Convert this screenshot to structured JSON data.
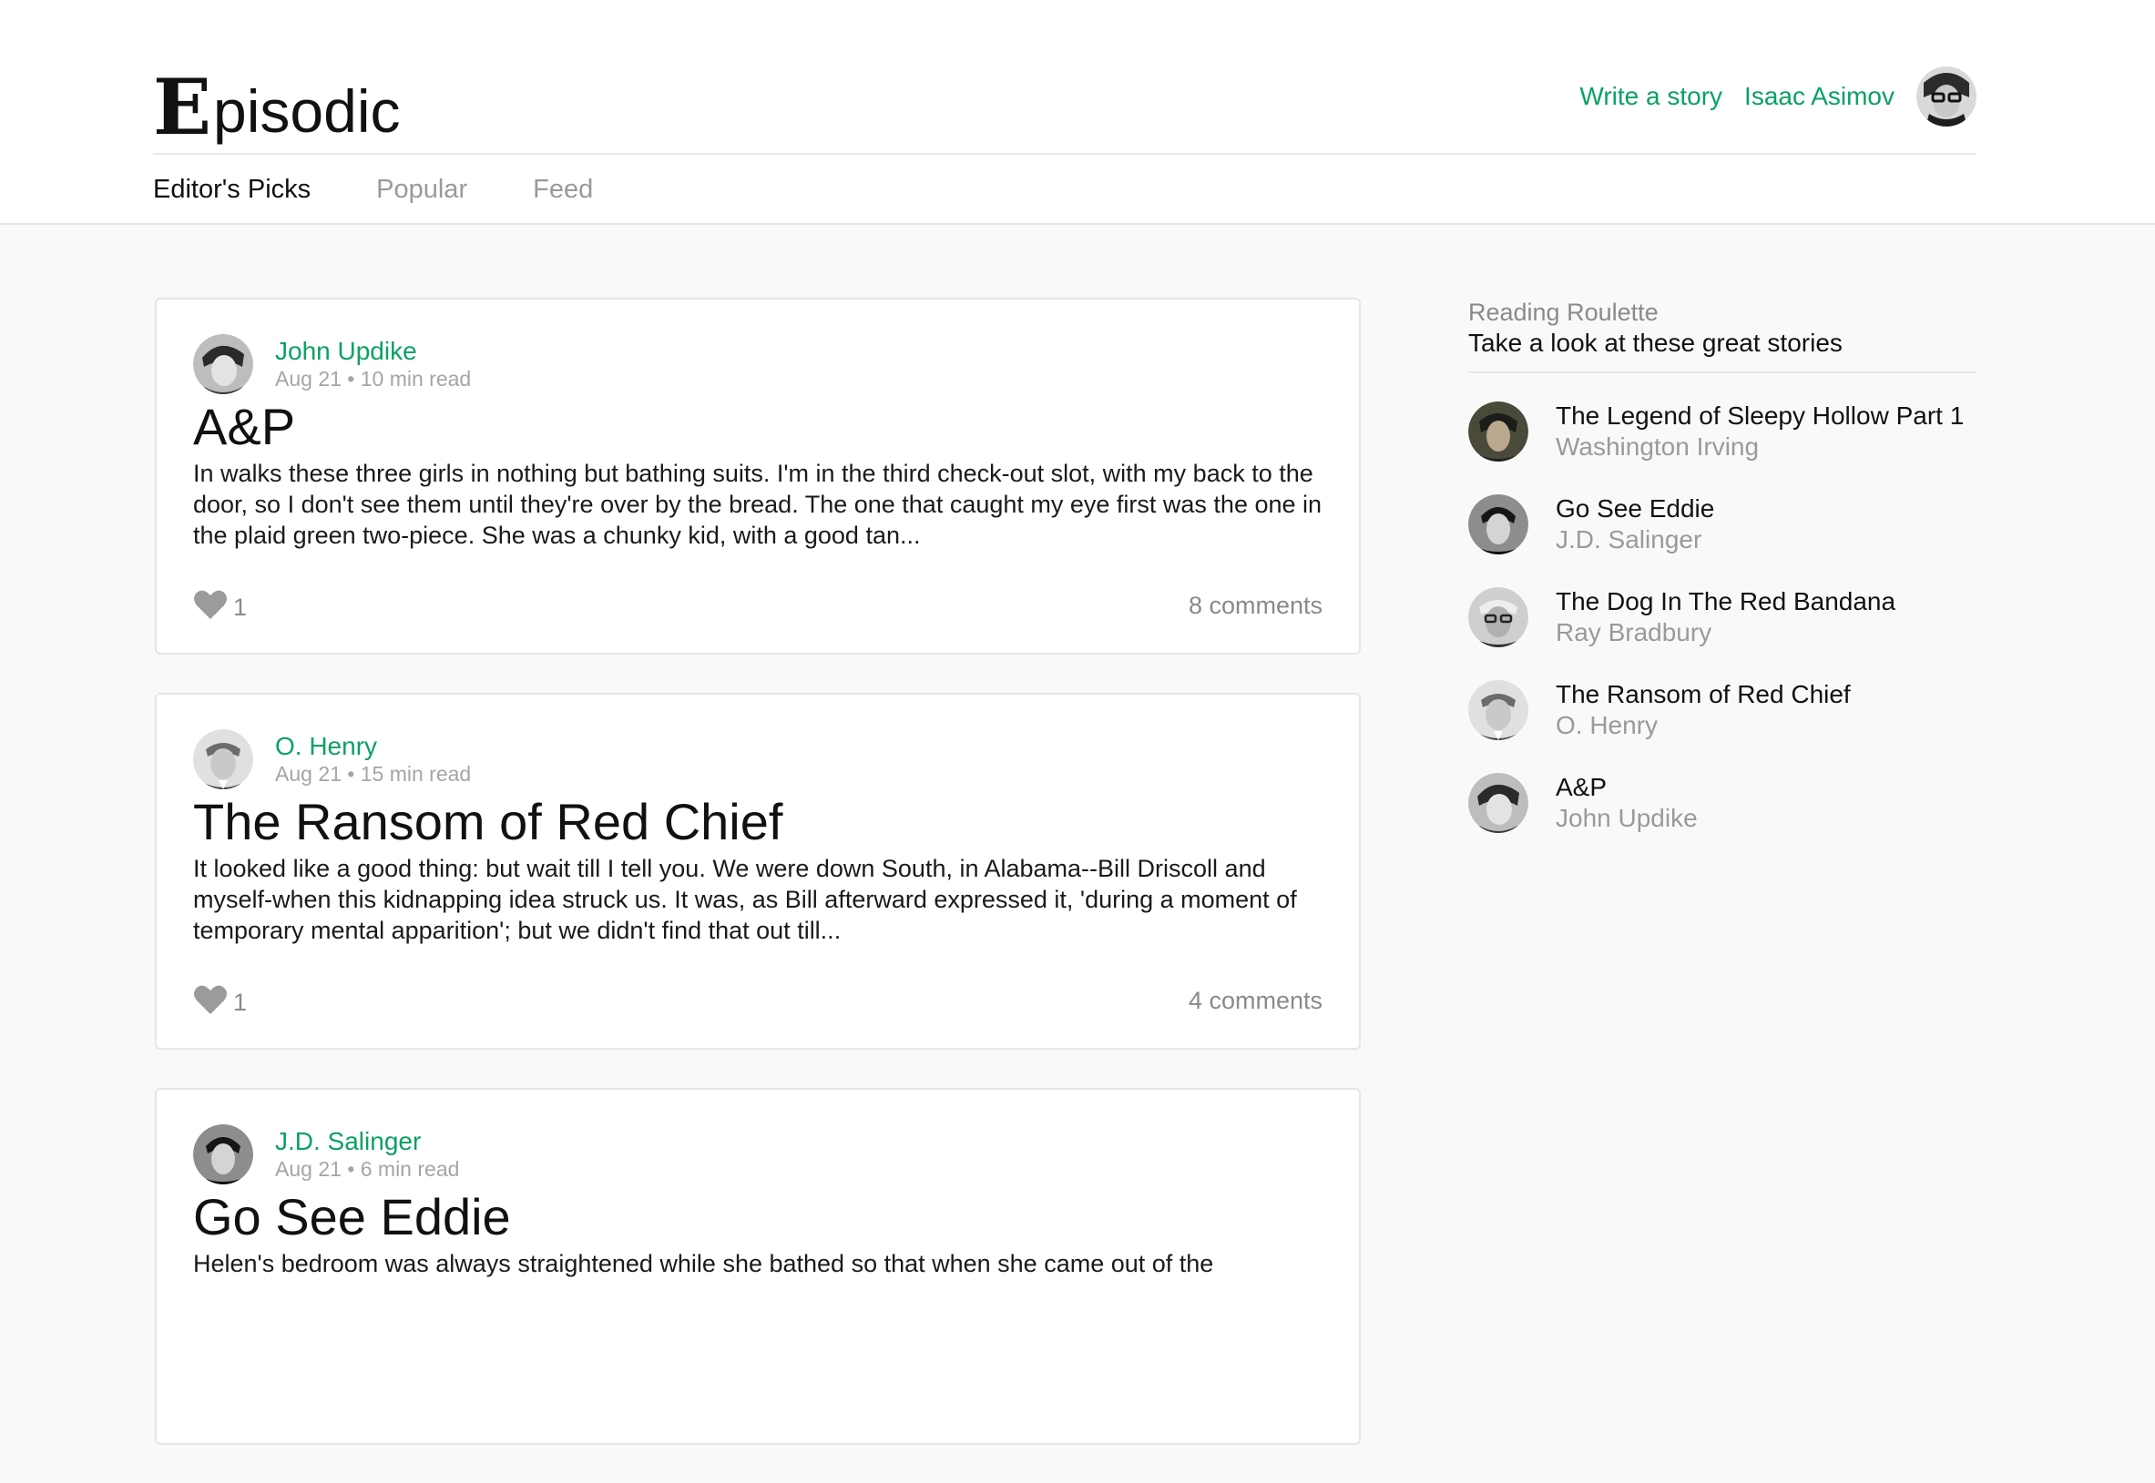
{
  "brand": {
    "initial": "E",
    "rest": "pisodic"
  },
  "header": {
    "write_label": "Write a story",
    "user_name": "Isaac Asimov"
  },
  "tabs": [
    {
      "label": "Editor's Picks",
      "active": true
    },
    {
      "label": "Popular",
      "active": false
    },
    {
      "label": "Feed",
      "active": false
    }
  ],
  "posts": [
    {
      "author": "John Updike",
      "meta": "Aug 21 • 10 min read",
      "title": "A&P",
      "excerpt": "In walks these three girls in nothing but bathing suits. I'm in the third check-out slot, with my back to the door, so I don't see them until they're over by the bread. The one that caught my eye first was the one in the plaid green two-piece. She was a chunky kid, with a good tan...",
      "likes": "1",
      "comments": "8 comments"
    },
    {
      "author": "O. Henry",
      "meta": "Aug 21 • 15 min read",
      "title": "The Ransom of Red Chief",
      "excerpt": "It looked like a good thing: but wait till I tell you. We were down South, in Alabama--Bill Driscoll and myself-when this kidnapping idea struck us. It was, as Bill afterward expressed it, 'during a moment of temporary mental apparition'; but we didn't find that out till...",
      "likes": "1",
      "comments": "4 comments"
    },
    {
      "author": "J.D. Salinger",
      "meta": "Aug 21 • 6 min read",
      "title": "Go See Eddie",
      "excerpt": "Helen's bedroom was always straightened while she bathed so that when she came out of the",
      "likes": "",
      "comments": ""
    }
  ],
  "sidebar": {
    "title": "Reading Roulette",
    "subtitle": "Take a look at these great stories",
    "items": [
      {
        "story": "The Legend of Sleepy Hollow Part 1",
        "author": "Washington Irving"
      },
      {
        "story": "Go See Eddie",
        "author": "J.D. Salinger"
      },
      {
        "story": "The Dog In The Red Bandana",
        "author": "Ray Bradbury"
      },
      {
        "story": "The Ransom of Red Chief",
        "author": "O. Henry"
      },
      {
        "story": "A&P",
        "author": "John Updike"
      }
    ]
  },
  "colors": {
    "accent": "#0aa164",
    "background": "#f9f9f9",
    "card": "#ffffff"
  }
}
